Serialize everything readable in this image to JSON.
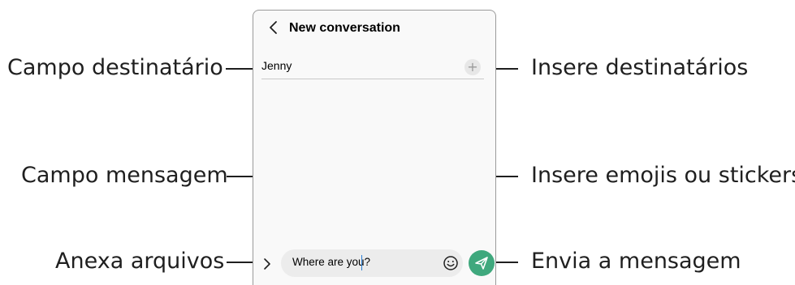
{
  "screen": {
    "title": "New conversation",
    "recipient_value": "Jenny",
    "add_recipient_glyph": "+",
    "message_value": "Where are you?",
    "icons": [
      "back-arrow-icon",
      "plus-icon",
      "chevron-right-icon",
      "emoji-icon",
      "send-icon"
    ],
    "accent_color": "#3fa87d"
  },
  "callouts": {
    "recipient_field": "Campo destinatário",
    "add_recipients": "Insere destinatários",
    "message_field": "Campo mensagem",
    "emoji_stickers": "Insere emojis ou stickers",
    "attach_files": "Anexa arquivos",
    "send_message": "Envia a mensagem"
  }
}
